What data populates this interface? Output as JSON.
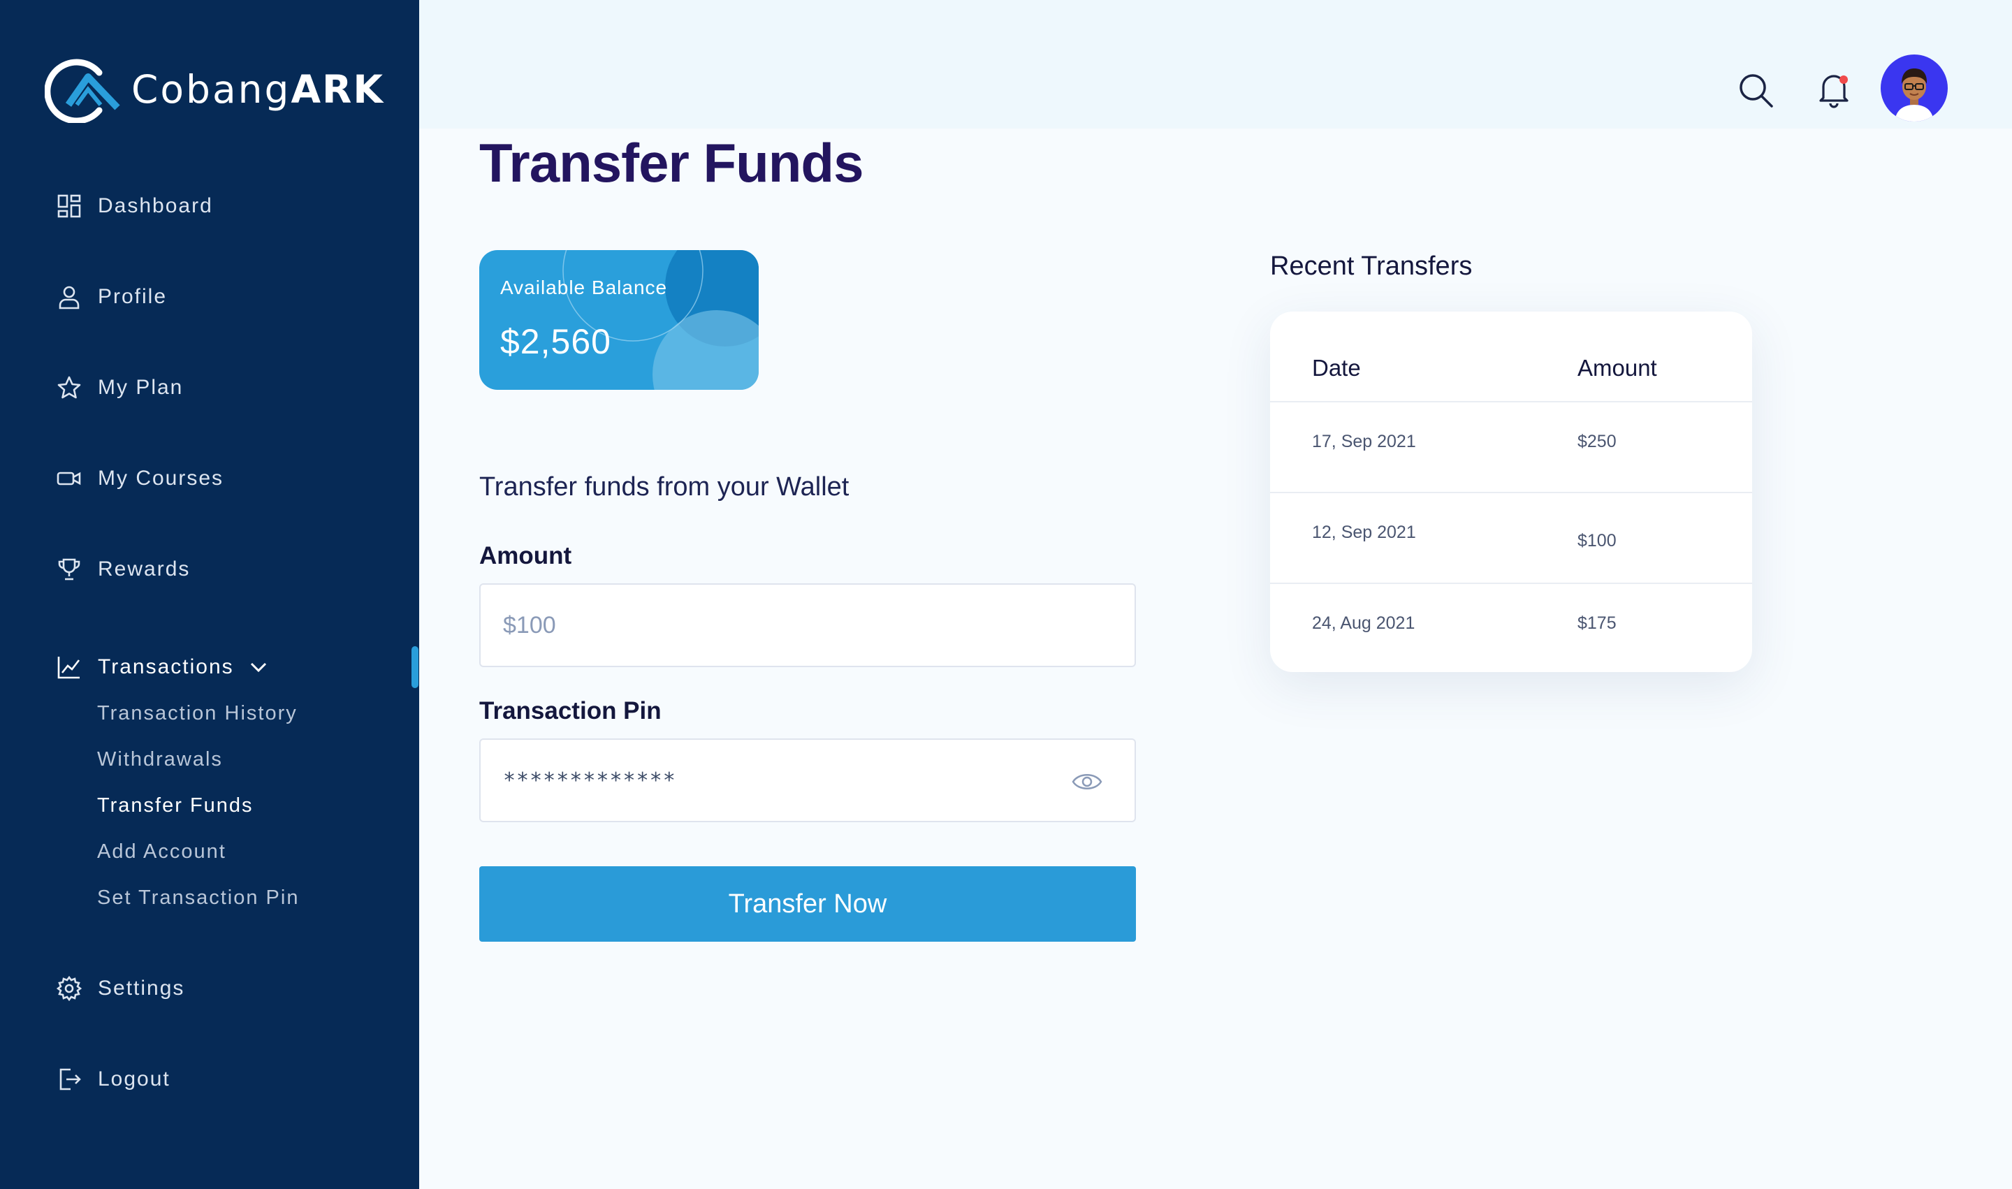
{
  "brand": {
    "name_light": "Cobang",
    "name_bold": "ARK"
  },
  "sidebar": {
    "items": [
      {
        "label": "Dashboard",
        "icon": "dashboard-icon"
      },
      {
        "label": "Profile",
        "icon": "user-icon"
      },
      {
        "label": "My Plan",
        "icon": "star-icon"
      },
      {
        "label": "My Courses",
        "icon": "video-icon"
      },
      {
        "label": "Rewards",
        "icon": "trophy-icon"
      },
      {
        "label": "Transactions",
        "icon": "chart-icon",
        "expanded": true
      },
      {
        "label": "Settings",
        "icon": "gear-icon"
      },
      {
        "label": "Logout",
        "icon": "logout-icon"
      }
    ],
    "sub_items": [
      {
        "label": "Transaction History"
      },
      {
        "label": "Withdrawals"
      },
      {
        "label": "Transfer Funds",
        "current": true
      },
      {
        "label": "Add Account"
      },
      {
        "label": "Set Transaction Pin"
      }
    ]
  },
  "page": {
    "title": "Transfer Funds"
  },
  "balance": {
    "label": "Available Balance",
    "value": "$2,560"
  },
  "form": {
    "section_title": "Transfer funds from your Wallet",
    "amount_label": "Amount",
    "amount_placeholder": "$100",
    "pin_label": "Transaction Pin",
    "pin_value": "*************",
    "submit_label": "Transfer Now"
  },
  "recent": {
    "title": "Recent Transfers",
    "columns": [
      "Date",
      "Amount"
    ],
    "rows": [
      {
        "date": "17, Sep 2021",
        "amount": "$250"
      },
      {
        "date": "12, Sep 2021",
        "amount": "$100"
      },
      {
        "date": "24, Aug 2021",
        "amount": "$175"
      }
    ]
  },
  "colors": {
    "sidebar_bg": "#062a56",
    "accent": "#2a9bd8",
    "title": "#23155f",
    "notification_dot": "#f04b4b",
    "avatar_bg": "#3a36f0"
  }
}
